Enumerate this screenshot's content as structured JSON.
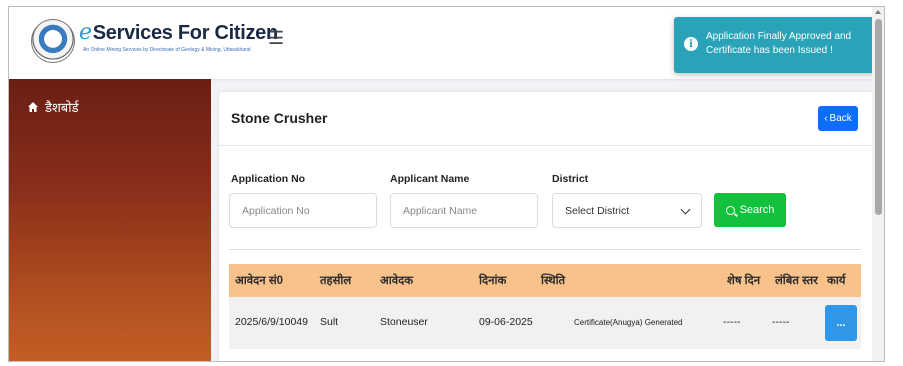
{
  "header": {
    "brand_prefix": "e",
    "brand_title": "Services For Citizen",
    "brand_subtitle": "An Online Mining Services by Directorate of Geology & Mining, Uttarakhand",
    "menu_icon": "hamburger-icon"
  },
  "sidebar": {
    "items": [
      {
        "icon": "home-icon",
        "label": "डैशबोर्ड"
      }
    ]
  },
  "notification": {
    "icon": "info-icon",
    "message": "Application Finally Approved and Certificate has been Issued !",
    "color": "#2aa3b8"
  },
  "card": {
    "title": "Stone Crusher",
    "back_label": "Back"
  },
  "search": {
    "application_no_label": "Application No",
    "application_no_placeholder": "Application No",
    "applicant_name_label": "Applicant Name",
    "applicant_name_placeholder": "Applicant Name",
    "district_label": "District",
    "district_selected": "Select District",
    "search_label": "Search"
  },
  "table": {
    "headers": [
      "आवेदन सं0",
      "तहसील",
      "आवेदक",
      "दिनांक",
      "स्थिति",
      "शेष दिन",
      "लंबित स्तर",
      "कार्य"
    ],
    "rows": [
      {
        "application_no": "2025/6/9/10049",
        "tehsil": "Sult",
        "applicant": "Stoneuser",
        "date": "09-06-2025",
        "status": "Certificate(Anugya) Generated",
        "days_left": "-----",
        "pending_level": "-----",
        "action": "..."
      }
    ],
    "header_color": "#f9c28a"
  },
  "colors": {
    "primary": "#0d6efd",
    "success": "#12c23c",
    "sidebar_top": "#6b1e14",
    "sidebar_bottom": "#c45e24"
  }
}
